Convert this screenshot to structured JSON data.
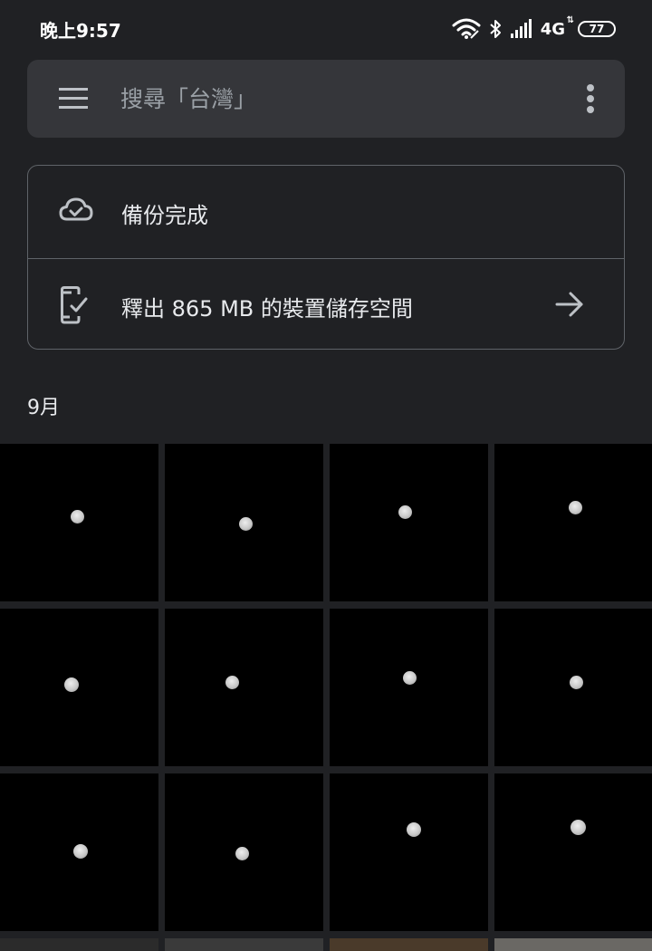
{
  "status_bar": {
    "time": "晚上9:57",
    "network": "4G",
    "network_arrows": "⇅",
    "battery": "77",
    "icons": [
      "wifi-icon",
      "bluetooth-icon",
      "signal-icon",
      "battery-icon"
    ]
  },
  "search": {
    "placeholder": "搜尋「台灣」",
    "icons": [
      "menu-icon",
      "more-vertical-icon"
    ]
  },
  "backup_card": {
    "status_label": "備份完成",
    "status_icon": "cloud-done-icon",
    "free_up_label": "釋出 865 MB 的裝置儲存空間",
    "free_up_icon": "phone-check-icon",
    "arrow_icon": "arrow-right-icon"
  },
  "photos": {
    "month": "9月",
    "thumbnail_type": "moon photo",
    "rows": 3,
    "columns": 4
  },
  "colors": {
    "background": "#202124",
    "search_bar": "#35363a",
    "card_border": "#5f6368",
    "text_primary": "#e8eaed",
    "text_secondary": "#9aa0a6",
    "photo_background": "#000000"
  }
}
